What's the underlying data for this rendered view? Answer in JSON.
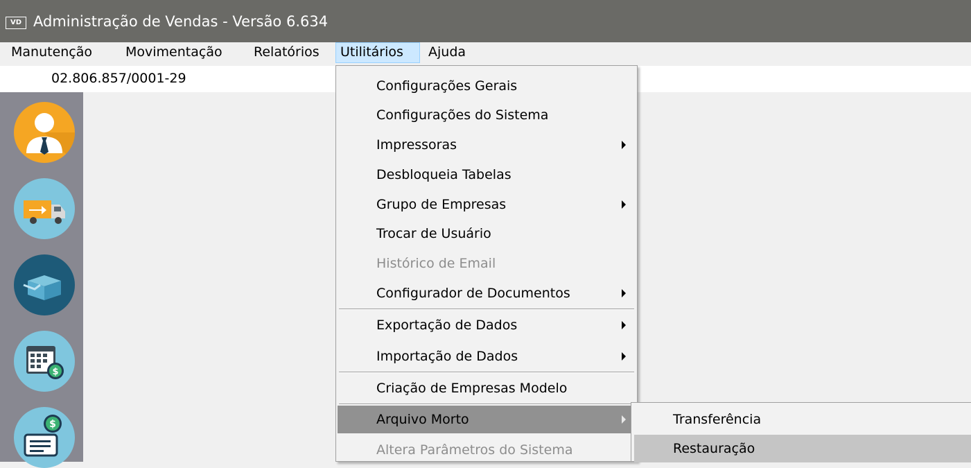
{
  "window": {
    "icon_text": "VD",
    "title": "Administração de Vendas - Versão 6.634"
  },
  "menubar": {
    "items": [
      "Manutenção",
      "Movimentação",
      "Relatórios",
      "Utilitários",
      "Ajuda"
    ],
    "active": "Utilitários"
  },
  "company": {
    "cnpj": "02.806.857/0001-29"
  },
  "sidebar": {
    "buttons": [
      "person-icon",
      "delivery-truck-icon",
      "box-icon",
      "calendar-money-icon",
      "receipt-money-icon"
    ]
  },
  "utilitarios_menu": {
    "items": [
      {
        "label": "Configurações Gerais",
        "submenu": false,
        "enabled": true
      },
      {
        "label": "Configurações do Sistema",
        "submenu": false,
        "enabled": true
      },
      {
        "label": "Impressoras",
        "submenu": true,
        "enabled": true
      },
      {
        "label": "Desbloqueia Tabelas",
        "submenu": false,
        "enabled": true
      },
      {
        "label": "Grupo de Empresas",
        "submenu": true,
        "enabled": true
      },
      {
        "label": "Trocar de Usuário",
        "submenu": false,
        "enabled": true
      },
      {
        "label": "Histórico de Email",
        "submenu": false,
        "enabled": false
      },
      {
        "label": "Configurador de Documentos",
        "submenu": true,
        "enabled": true
      },
      {
        "label": "Exportação de Dados",
        "submenu": true,
        "enabled": true
      },
      {
        "label": "Importação de Dados",
        "submenu": true,
        "enabled": true
      },
      {
        "label": "Criação de Empresas Modelo",
        "submenu": false,
        "enabled": true
      },
      {
        "label": "Arquivo Morto",
        "submenu": true,
        "enabled": true,
        "highlighted": true
      },
      {
        "label": "Altera Parâmetros do Sistema",
        "submenu": false,
        "enabled": false
      }
    ]
  },
  "arquivo_morto_submenu": {
    "items": [
      {
        "label": "Transferência"
      },
      {
        "label": "Restauração",
        "hovered": true
      }
    ]
  }
}
